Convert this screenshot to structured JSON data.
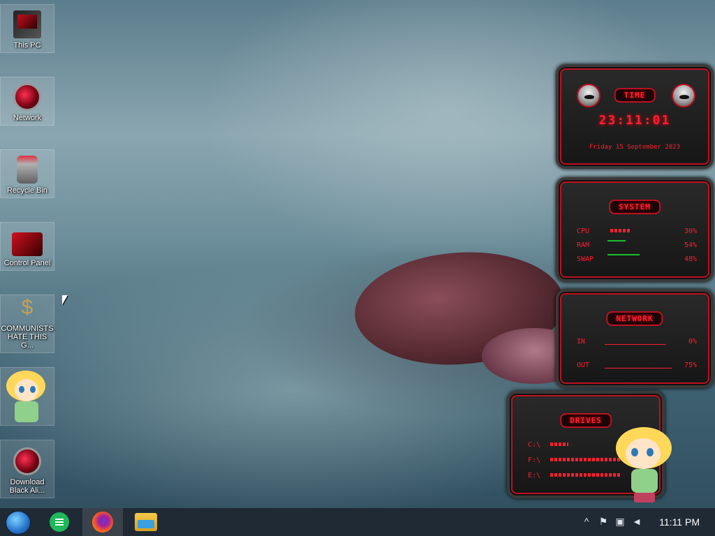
{
  "desktop": {
    "icons": [
      {
        "label": "This PC"
      },
      {
        "label": "Network"
      },
      {
        "label": "Recycle Bin"
      },
      {
        "label": "Control Panel"
      },
      {
        "label": "COMMUNISTS HATE THIS G..."
      },
      {
        "label": ""
      },
      {
        "label": "Download Black Ali..."
      }
    ]
  },
  "widgets": {
    "time": {
      "title": "TIME",
      "clock": "23:11:01",
      "date": "Friday 15 September 2023"
    },
    "system": {
      "title": "SYSTEM",
      "cpu_label": "CPU",
      "cpu_value": "30%",
      "ram_label": "RAM",
      "ram_value": "54%",
      "swap_label": "SWAP",
      "swap_value": "48%"
    },
    "network": {
      "title": "NETWORK",
      "in_label": "IN",
      "in_value": "0%",
      "out_label": "OUT",
      "out_value": "75%"
    },
    "drives": {
      "title": "DRIVES",
      "c_label": "C:\\",
      "f_label": "F:\\",
      "e_label": "E:\\"
    }
  },
  "taskbar": {
    "clock": "11:11 PM",
    "apps": [
      "start-orb",
      "notes-app",
      "firefox",
      "file-explorer"
    ],
    "tray": [
      "chevron-up-icon",
      "flag-icon",
      "network-warning-icon",
      "volume-icon"
    ]
  },
  "colors": {
    "accent": "#ff1f2e",
    "taskbar": "#1f2a34"
  }
}
